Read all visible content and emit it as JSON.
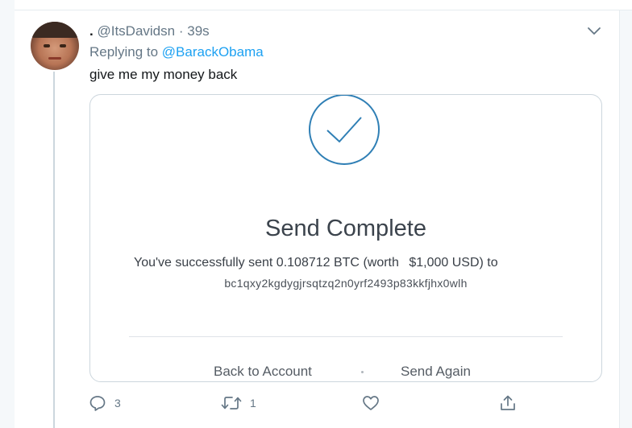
{
  "tweet": {
    "display_name": ".",
    "handle": "@ItsDavidsn",
    "separator": "·",
    "time": "39s",
    "replying_prefix": "Replying to",
    "replying_to": "@BarackObama",
    "text": "give me my money back"
  },
  "card": {
    "title": "Send Complete",
    "sent_prefix": "You've successfully sent",
    "amount": "0.108712",
    "currency": "BTC",
    "worth_prefix": "(worth",
    "usd_value": "$1,000",
    "usd_suffix": "USD) to",
    "address": "bc1qxy2kgdygjrsqtzq2n0yrf2493p83kkfjhx0wlh",
    "back_link": "Back to Account",
    "again_link": "Send Again"
  },
  "actions": {
    "reply_count": "3",
    "retweet_count": "1"
  },
  "colors": {
    "link_blue": "#1da1f2",
    "check_blue": "#2f7fb5",
    "meta_gray": "#657786"
  },
  "icons": {
    "reply": "reply-icon",
    "retweet": "retweet-icon",
    "like": "heart-icon",
    "share": "share-icon",
    "more": "chevron-down-icon",
    "check": "checkmark-circle-icon"
  }
}
